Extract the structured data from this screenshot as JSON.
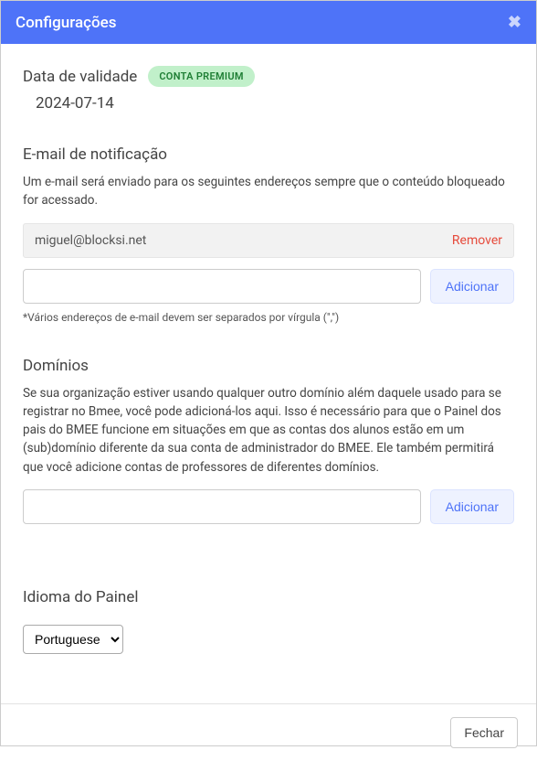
{
  "header": {
    "title": "Configurações"
  },
  "expiry": {
    "label": "Data de validade",
    "badge": "CONTA PREMIUM",
    "date": "2024-07-14"
  },
  "notification": {
    "title": "E-mail de notificação",
    "description": "Um e-mail será enviado para os seguintes endereços sempre que o conteúdo bloqueado for acessado.",
    "emails": [
      {
        "address": "miguel@blocksi.net"
      }
    ],
    "remove_label": "Remover",
    "add_label": "Adicionar",
    "hint": "*Vários endereços de e-mail devem ser separados por vírgula (\",\")"
  },
  "domains": {
    "title": "Domínios",
    "description": "Se sua organização estiver usando qualquer outro domínio além daquele usado para se registrar no Bmee, você pode adicioná-los aqui. Isso é necessário para que o Painel dos pais do BMEE funcione em situações em que as contas dos alunos estão em um (sub)domínio diferente da sua conta de administrador do BMEE. Ele também permitirá que você adicione contas de professores de diferentes domínios.",
    "add_label": "Adicionar"
  },
  "language": {
    "title": "Idioma do Painel",
    "selected": "Portuguese"
  },
  "footer": {
    "close_label": "Fechar"
  }
}
